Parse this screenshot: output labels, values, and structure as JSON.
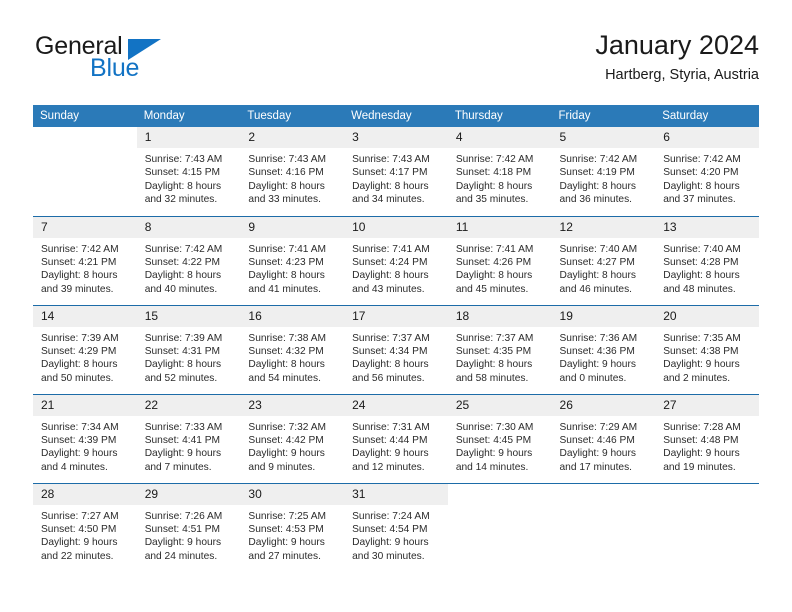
{
  "brand": {
    "name_primary": "General",
    "name_secondary": "Blue",
    "accent_color": "#1273c4"
  },
  "header": {
    "title": "January 2024",
    "location": "Hartberg, Styria, Austria"
  },
  "calendar": {
    "header_color": "#2b7ab8",
    "daynum_band_color": "#efefef",
    "row_border_color": "#1d6ca8",
    "weekday_headers": [
      "Sunday",
      "Monday",
      "Tuesday",
      "Wednesday",
      "Thursday",
      "Friday",
      "Saturday"
    ],
    "weeks": [
      [
        {
          "empty": true
        },
        {
          "day": "1",
          "sunrise": "Sunrise: 7:43 AM",
          "sunset": "Sunset: 4:15 PM",
          "daylight_line1": "Daylight: 8 hours",
          "daylight_line2": "and 32 minutes."
        },
        {
          "day": "2",
          "sunrise": "Sunrise: 7:43 AM",
          "sunset": "Sunset: 4:16 PM",
          "daylight_line1": "Daylight: 8 hours",
          "daylight_line2": "and 33 minutes."
        },
        {
          "day": "3",
          "sunrise": "Sunrise: 7:43 AM",
          "sunset": "Sunset: 4:17 PM",
          "daylight_line1": "Daylight: 8 hours",
          "daylight_line2": "and 34 minutes."
        },
        {
          "day": "4",
          "sunrise": "Sunrise: 7:42 AM",
          "sunset": "Sunset: 4:18 PM",
          "daylight_line1": "Daylight: 8 hours",
          "daylight_line2": "and 35 minutes."
        },
        {
          "day": "5",
          "sunrise": "Sunrise: 7:42 AM",
          "sunset": "Sunset: 4:19 PM",
          "daylight_line1": "Daylight: 8 hours",
          "daylight_line2": "and 36 minutes."
        },
        {
          "day": "6",
          "sunrise": "Sunrise: 7:42 AM",
          "sunset": "Sunset: 4:20 PM",
          "daylight_line1": "Daylight: 8 hours",
          "daylight_line2": "and 37 minutes."
        }
      ],
      [
        {
          "day": "7",
          "sunrise": "Sunrise: 7:42 AM",
          "sunset": "Sunset: 4:21 PM",
          "daylight_line1": "Daylight: 8 hours",
          "daylight_line2": "and 39 minutes."
        },
        {
          "day": "8",
          "sunrise": "Sunrise: 7:42 AM",
          "sunset": "Sunset: 4:22 PM",
          "daylight_line1": "Daylight: 8 hours",
          "daylight_line2": "and 40 minutes."
        },
        {
          "day": "9",
          "sunrise": "Sunrise: 7:41 AM",
          "sunset": "Sunset: 4:23 PM",
          "daylight_line1": "Daylight: 8 hours",
          "daylight_line2": "and 41 minutes."
        },
        {
          "day": "10",
          "sunrise": "Sunrise: 7:41 AM",
          "sunset": "Sunset: 4:24 PM",
          "daylight_line1": "Daylight: 8 hours",
          "daylight_line2": "and 43 minutes."
        },
        {
          "day": "11",
          "sunrise": "Sunrise: 7:41 AM",
          "sunset": "Sunset: 4:26 PM",
          "daylight_line1": "Daylight: 8 hours",
          "daylight_line2": "and 45 minutes."
        },
        {
          "day": "12",
          "sunrise": "Sunrise: 7:40 AM",
          "sunset": "Sunset: 4:27 PM",
          "daylight_line1": "Daylight: 8 hours",
          "daylight_line2": "and 46 minutes."
        },
        {
          "day": "13",
          "sunrise": "Sunrise: 7:40 AM",
          "sunset": "Sunset: 4:28 PM",
          "daylight_line1": "Daylight: 8 hours",
          "daylight_line2": "and 48 minutes."
        }
      ],
      [
        {
          "day": "14",
          "sunrise": "Sunrise: 7:39 AM",
          "sunset": "Sunset: 4:29 PM",
          "daylight_line1": "Daylight: 8 hours",
          "daylight_line2": "and 50 minutes."
        },
        {
          "day": "15",
          "sunrise": "Sunrise: 7:39 AM",
          "sunset": "Sunset: 4:31 PM",
          "daylight_line1": "Daylight: 8 hours",
          "daylight_line2": "and 52 minutes."
        },
        {
          "day": "16",
          "sunrise": "Sunrise: 7:38 AM",
          "sunset": "Sunset: 4:32 PM",
          "daylight_line1": "Daylight: 8 hours",
          "daylight_line2": "and 54 minutes."
        },
        {
          "day": "17",
          "sunrise": "Sunrise: 7:37 AM",
          "sunset": "Sunset: 4:34 PM",
          "daylight_line1": "Daylight: 8 hours",
          "daylight_line2": "and 56 minutes."
        },
        {
          "day": "18",
          "sunrise": "Sunrise: 7:37 AM",
          "sunset": "Sunset: 4:35 PM",
          "daylight_line1": "Daylight: 8 hours",
          "daylight_line2": "and 58 minutes."
        },
        {
          "day": "19",
          "sunrise": "Sunrise: 7:36 AM",
          "sunset": "Sunset: 4:36 PM",
          "daylight_line1": "Daylight: 9 hours",
          "daylight_line2": "and 0 minutes."
        },
        {
          "day": "20",
          "sunrise": "Sunrise: 7:35 AM",
          "sunset": "Sunset: 4:38 PM",
          "daylight_line1": "Daylight: 9 hours",
          "daylight_line2": "and 2 minutes."
        }
      ],
      [
        {
          "day": "21",
          "sunrise": "Sunrise: 7:34 AM",
          "sunset": "Sunset: 4:39 PM",
          "daylight_line1": "Daylight: 9 hours",
          "daylight_line2": "and 4 minutes."
        },
        {
          "day": "22",
          "sunrise": "Sunrise: 7:33 AM",
          "sunset": "Sunset: 4:41 PM",
          "daylight_line1": "Daylight: 9 hours",
          "daylight_line2": "and 7 minutes."
        },
        {
          "day": "23",
          "sunrise": "Sunrise: 7:32 AM",
          "sunset": "Sunset: 4:42 PM",
          "daylight_line1": "Daylight: 9 hours",
          "daylight_line2": "and 9 minutes."
        },
        {
          "day": "24",
          "sunrise": "Sunrise: 7:31 AM",
          "sunset": "Sunset: 4:44 PM",
          "daylight_line1": "Daylight: 9 hours",
          "daylight_line2": "and 12 minutes."
        },
        {
          "day": "25",
          "sunrise": "Sunrise: 7:30 AM",
          "sunset": "Sunset: 4:45 PM",
          "daylight_line1": "Daylight: 9 hours",
          "daylight_line2": "and 14 minutes."
        },
        {
          "day": "26",
          "sunrise": "Sunrise: 7:29 AM",
          "sunset": "Sunset: 4:46 PM",
          "daylight_line1": "Daylight: 9 hours",
          "daylight_line2": "and 17 minutes."
        },
        {
          "day": "27",
          "sunrise": "Sunrise: 7:28 AM",
          "sunset": "Sunset: 4:48 PM",
          "daylight_line1": "Daylight: 9 hours",
          "daylight_line2": "and 19 minutes."
        }
      ],
      [
        {
          "day": "28",
          "sunrise": "Sunrise: 7:27 AM",
          "sunset": "Sunset: 4:50 PM",
          "daylight_line1": "Daylight: 9 hours",
          "daylight_line2": "and 22 minutes."
        },
        {
          "day": "29",
          "sunrise": "Sunrise: 7:26 AM",
          "sunset": "Sunset: 4:51 PM",
          "daylight_line1": "Daylight: 9 hours",
          "daylight_line2": "and 24 minutes."
        },
        {
          "day": "30",
          "sunrise": "Sunrise: 7:25 AM",
          "sunset": "Sunset: 4:53 PM",
          "daylight_line1": "Daylight: 9 hours",
          "daylight_line2": "and 27 minutes."
        },
        {
          "day": "31",
          "sunrise": "Sunrise: 7:24 AM",
          "sunset": "Sunset: 4:54 PM",
          "daylight_line1": "Daylight: 9 hours",
          "daylight_line2": "and 30 minutes."
        },
        {
          "empty": true
        },
        {
          "empty": true
        },
        {
          "empty": true
        }
      ]
    ]
  }
}
